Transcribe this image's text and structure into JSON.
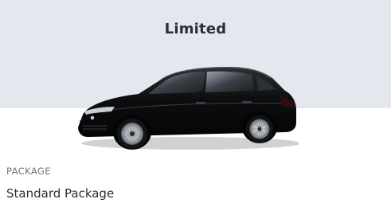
{
  "trim": {
    "name": "Limited"
  },
  "vehicle": {
    "image_icon": "sedan-car-image",
    "color": "#0d0e10"
  },
  "package": {
    "label": "PACKAGE",
    "value": "Standard Package"
  },
  "colors": {
    "hero_background": "#e4e8ee",
    "title_text": "#2a2f36",
    "muted_text": "#6e737a"
  }
}
